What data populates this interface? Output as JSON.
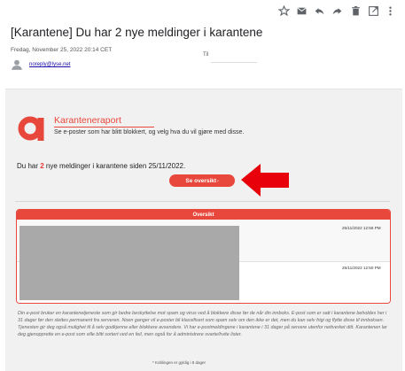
{
  "toolbar": {
    "icons": [
      "star-icon",
      "mark-unread-icon",
      "reply-icon",
      "forward-icon",
      "delete-icon",
      "open-external-icon",
      "more-icon"
    ]
  },
  "email": {
    "subject": "[Karantene] Du har 2 nye meldinger i karantene",
    "date": "Fredag, November 25, 2022 20:14 CET",
    "sender": "noreply@lyse.net",
    "to_label": "Til"
  },
  "report": {
    "title": "Karanteneraport",
    "subtitle": "Se e-poster som har blitt blokkert, og velg hva du vil gjøre med disse.",
    "notice_prefix": "Du har ",
    "notice_count": "2",
    "notice_suffix": " nye meldinger i karantene siden 25/11/2022.",
    "button_label": "Se oversikt",
    "button_mark": "*",
    "accent_color": "#e8473c"
  },
  "overview": {
    "header": "Oversikt",
    "rows": [
      {
        "timestamp": "25/11/2022 12:56 PM"
      },
      {
        "timestamp": "25/11/2022 12:50 PM"
      }
    ]
  },
  "footer": {
    "text": "Din e-post bruker en karantenetjeneste som gir bedre beskyttelse mot spam og virus ved å blokkere disse før de når din innboks. E-post som er satt i karantene beholdes her i 31 dager før den slettes permanent fra serveren. Noen ganger vil e-poster bli klassifisert som spam selv om den ikke er det, men du kan selv frigi og flytte disse til innboksen. Tjenesten gir deg også mulighet til å selv godkjenne eller blokkere avsendere. Vi har e-postmeldingene i karantene i 31 dager på servere utenfor nettverket ditt. Karantenen lar deg gjenopprette en e-post som ville blitt sortert ved en feil, men også for å administrere svarte/hvite lister.",
    "footnote": "* Koblingen er gyldig i 8 dager"
  }
}
